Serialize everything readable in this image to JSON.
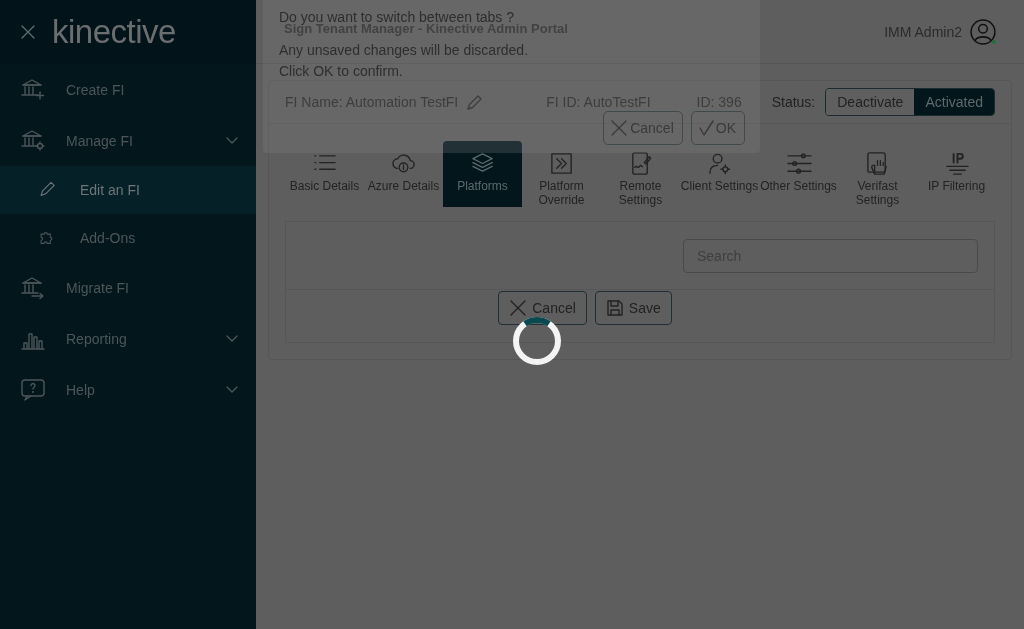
{
  "sidebar": {
    "logo": "kinective",
    "items": [
      {
        "label": "Create FI",
        "has_submenu": false,
        "selected": false
      },
      {
        "label": "Manage FI",
        "has_submenu": true,
        "selected": false,
        "children": [
          {
            "label": "Edit an FI",
            "selected": true
          },
          {
            "label": "Add-Ons",
            "selected": false
          }
        ]
      },
      {
        "label": "Migrate FI",
        "has_submenu": false,
        "selected": false
      },
      {
        "label": "Reporting",
        "has_submenu": true,
        "selected": false
      },
      {
        "label": "Help",
        "has_submenu": true,
        "selected": false
      }
    ]
  },
  "header": {
    "title": "Sign Tenant Manager - Kinective Admin Portal",
    "user_name": "IMM Admin2"
  },
  "fi_info": {
    "name": "FI Name: Automation TestFI",
    "fi_id": "FI ID: AutoTestFI",
    "id": "ID: 396",
    "status_label": "Status:",
    "status_options": [
      {
        "label": "Deactivate",
        "selected": false
      },
      {
        "label": "Activated",
        "selected": true
      }
    ]
  },
  "tabs": [
    {
      "label": "Basic Details",
      "selected": false
    },
    {
      "label": "Azure Details",
      "selected": false
    },
    {
      "label": "Platforms",
      "selected": true
    },
    {
      "label": "Platform Override",
      "selected": false
    },
    {
      "label": "Remote Settings",
      "selected": false
    },
    {
      "label": "Client Settings",
      "selected": false
    },
    {
      "label": "Other Settings",
      "selected": false
    },
    {
      "label": "Verifast Settings",
      "selected": false
    },
    {
      "label": "IP Filtering",
      "selected": false
    }
  ],
  "panel": {
    "search_placeholder": "Search",
    "buttons": [
      "Cancel",
      "Save"
    ]
  },
  "dialog": {
    "lines": [
      "Do you want to switch between tabs ?",
      "Any unsaved changes will be discarded.",
      "Click OK to confirm."
    ],
    "buttons": [
      "Cancel",
      "OK"
    ]
  }
}
